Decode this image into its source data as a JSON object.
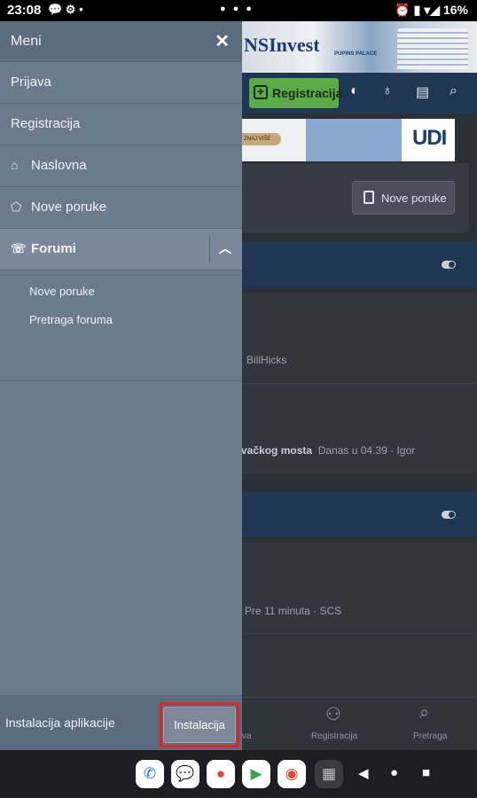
{
  "status_bar": {
    "time": "23:08",
    "battery": "16%"
  },
  "background": {
    "ad_top_brand": "NSInvest",
    "ad_top_sub": "PUPINS PALACE",
    "register_button": "Registracija",
    "ad_mid_pill": "ZNAJ VIŠE",
    "ad_mid_brand": "UDI",
    "new_posts_button": "Nove poruke",
    "row1_user": "BillHicks",
    "row2_bold": "vačkog mosta",
    "row2_meta": "Danas u 04.39 · Igor",
    "row3_meta": "Pre 11 minuta · SCS",
    "bottom_nav": {
      "partial_label": "va",
      "register_label": "Registracija",
      "search_label": "Pretraga"
    }
  },
  "drawer": {
    "title": "Meni",
    "items": [
      {
        "label": "Prijava",
        "icon": ""
      },
      {
        "label": "Registracija",
        "icon": ""
      },
      {
        "label": "Naslovna",
        "icon": "home-icon"
      },
      {
        "label": "Nove poruke",
        "icon": "tag-icon"
      },
      {
        "label": "Forumi",
        "icon": "chat-bubbles-icon"
      }
    ],
    "subitems": [
      "Nove poruke",
      "Pretraga foruma"
    ],
    "install_label": "Instalacija aplikacije",
    "install_button": "Instalacija"
  }
}
